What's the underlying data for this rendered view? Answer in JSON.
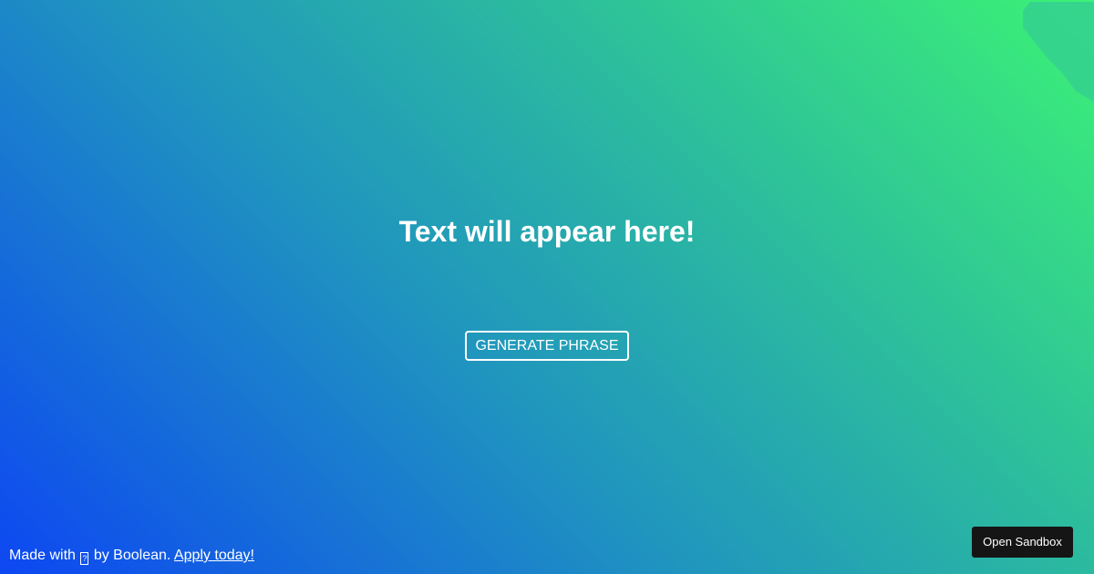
{
  "colors": {
    "gradient_bottom_left": "#0d47f2",
    "gradient_top_right": "#3cf275",
    "corner_shape": "#35d18f",
    "text": "#ffffff",
    "sandbox_button_bg": "#151515"
  },
  "main": {
    "headline": "Text will appear here!",
    "generate_button_label": "GENERATE PHRASE"
  },
  "footer": {
    "prefix": "Made with",
    "heart_glyph": "?",
    "middle": "by Boolean.",
    "link_label": "Apply today!"
  },
  "sandbox": {
    "button_label": "Open Sandbox"
  }
}
